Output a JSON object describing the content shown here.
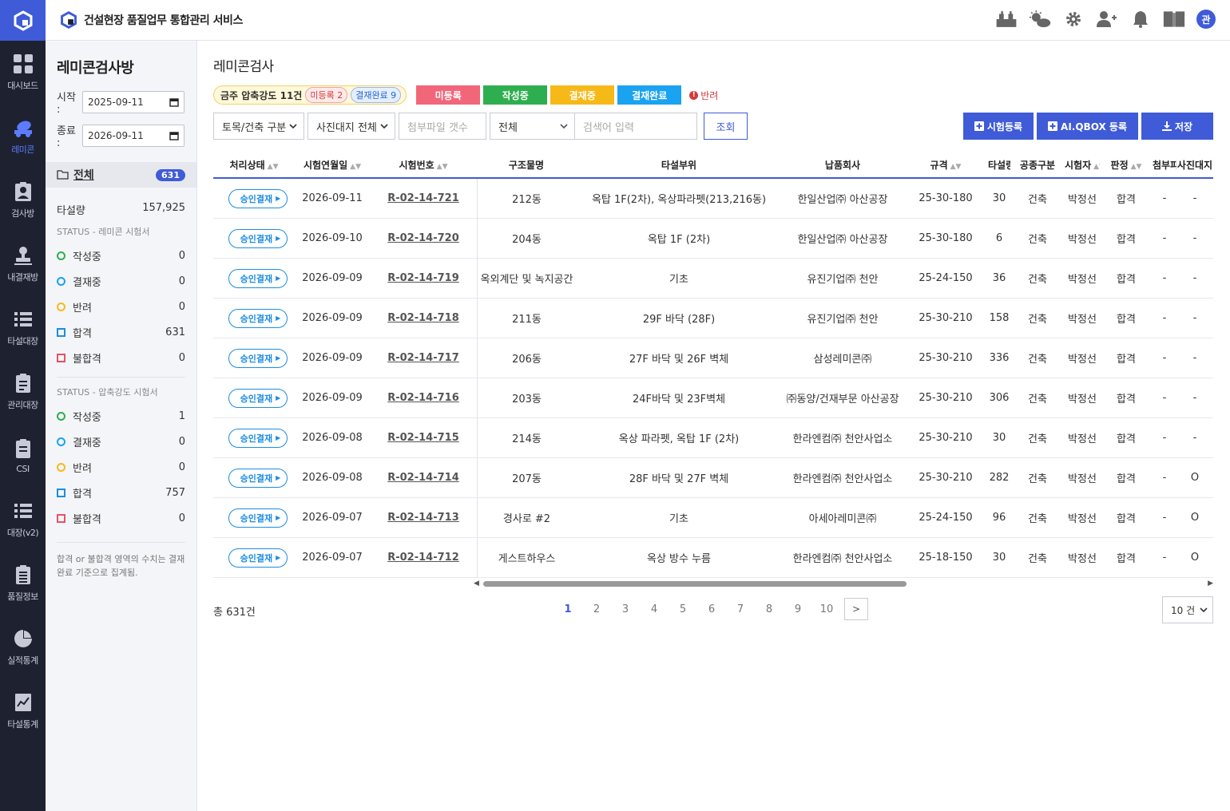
{
  "header": {
    "app_title": "건설현장 품질업무 통합관리 서비스",
    "avatar_initial": "관",
    "icons": [
      "factory-icon",
      "weather-icon",
      "settings-icon",
      "add-user-icon",
      "bell-icon",
      "book-icon"
    ]
  },
  "rail": {
    "items": [
      {
        "label": "대시보드",
        "icon": "dashboard-icon",
        "active": false
      },
      {
        "label": "레미콘",
        "icon": "mixer-truck-icon",
        "active": true
      },
      {
        "label": "검사방",
        "icon": "inspector-icon",
        "active": false
      },
      {
        "label": "내결재방",
        "icon": "stamp-icon",
        "active": false
      },
      {
        "label": "타설대장",
        "icon": "pour-ledger-icon",
        "active": false
      },
      {
        "label": "관리대장",
        "icon": "clipboard-icon",
        "active": false
      },
      {
        "label": "CSI",
        "icon": "csi-clipboard-icon",
        "active": false
      },
      {
        "label": "대장(v2)",
        "icon": "ledger-v2-icon",
        "active": false
      },
      {
        "label": "품질정보",
        "icon": "quality-list-icon",
        "active": false
      },
      {
        "label": "실적통계",
        "icon": "pie-chart-icon",
        "active": false
      },
      {
        "label": "타설통계",
        "icon": "line-chart-icon",
        "active": false
      }
    ]
  },
  "side": {
    "title": "레미콘검사방",
    "start_label": "시작 :",
    "start_value": "2025-09-11",
    "end_label": "종료 :",
    "end_value": "2026-09-11",
    "all_label": "전체",
    "all_count": "631",
    "pour_label": "타설량",
    "pour_value": "157,925",
    "status1_title": "STATUS - 레미콘 시험서",
    "status1": [
      {
        "label": "작성중",
        "value": "0"
      },
      {
        "label": "결재중",
        "value": "0"
      },
      {
        "label": "반려",
        "value": "0"
      },
      {
        "label": "합격",
        "value": "631"
      },
      {
        "label": "불합격",
        "value": "0"
      }
    ],
    "status2_title": "STATUS - 압축강도 시험서",
    "status2": [
      {
        "label": "작성중",
        "value": "1"
      },
      {
        "label": "결재중",
        "value": "0"
      },
      {
        "label": "반려",
        "value": "0"
      },
      {
        "label": "합격",
        "value": "757"
      },
      {
        "label": "불합격",
        "value": "0"
      }
    ],
    "note": "합격 or 불합격 영역의 수치는 결재완료 기준으로 집계됨."
  },
  "main": {
    "title": "레미콘검사",
    "weekly_label": "금주 압축강도 11건",
    "weekly_unregistered": "미등록 2",
    "weekly_done": "결재완료 9",
    "legend": [
      {
        "label": "미등록",
        "color": "#f2667a"
      },
      {
        "label": "작성중",
        "color": "#2fae4f"
      },
      {
        "label": "결재중",
        "color": "#f7b918"
      },
      {
        "label": "결재완료",
        "color": "#1aa3f0"
      }
    ],
    "reject_label": "반려",
    "filters": {
      "category": "토목/건축 구분",
      "photo": "사진대지 전체",
      "attach_placeholder": "첨부파일 갯수",
      "scope": "전체",
      "search_placeholder": "검색어 입력",
      "search_button": "조회"
    },
    "actions": {
      "register": "시험등록",
      "aiqbox": "AI.QBOX 등록",
      "save": "저장"
    }
  },
  "table": {
    "columns": [
      "처리상태",
      "시험연월일",
      "시험번호",
      "구조물명",
      "타설부위",
      "납품회사",
      "규격",
      "타설량",
      "공종구분",
      "시험자",
      "판정",
      "첨부파일",
      "사진대지"
    ],
    "rows": [
      {
        "status": "승인결재",
        "date": "2026-09-11",
        "no": "R-02-14-721",
        "structure": "212동",
        "part": "옥탑 1F(2차), 옥상파라펫(213,216동)",
        "company": "한일산업㈜ 아산공장",
        "spec": "25-30-180",
        "qty": "30",
        "type": "건축",
        "tester": "박정선",
        "result": "합격",
        "attach": "-",
        "photo": "-"
      },
      {
        "status": "승인결재",
        "date": "2026-09-10",
        "no": "R-02-14-720",
        "structure": "204동",
        "part": "옥탑 1F (2차)",
        "company": "한일산업㈜ 아산공장",
        "spec": "25-30-180",
        "qty": "6",
        "type": "건축",
        "tester": "박정선",
        "result": "합격",
        "attach": "-",
        "photo": "-"
      },
      {
        "status": "승인결재",
        "date": "2026-09-09",
        "no": "R-02-14-719",
        "structure": "옥외계단 및 녹지공간",
        "part": "기초",
        "company": "유진기업㈜ 천안",
        "spec": "25-24-150",
        "qty": "36",
        "type": "건축",
        "tester": "박정선",
        "result": "합격",
        "attach": "-",
        "photo": "-"
      },
      {
        "status": "승인결재",
        "date": "2026-09-09",
        "no": "R-02-14-718",
        "structure": "211동",
        "part": "29F 바닥 (28F)",
        "company": "유진기업㈜ 천안",
        "spec": "25-30-210",
        "qty": "158",
        "type": "건축",
        "tester": "박정선",
        "result": "합격",
        "attach": "-",
        "photo": "-"
      },
      {
        "status": "승인결재",
        "date": "2026-09-09",
        "no": "R-02-14-717",
        "structure": "206동",
        "part": "27F 바닥 및 26F 벽체",
        "company": "삼성레미콘㈜",
        "spec": "25-30-210",
        "qty": "336",
        "type": "건축",
        "tester": "박정선",
        "result": "합격",
        "attach": "-",
        "photo": "-"
      },
      {
        "status": "승인결재",
        "date": "2026-09-09",
        "no": "R-02-14-716",
        "structure": "203동",
        "part": "24F바닥 및 23F벽체",
        "company": "㈜동양/건재부문 아산공장",
        "spec": "25-30-210",
        "qty": "306",
        "type": "건축",
        "tester": "박정선",
        "result": "합격",
        "attach": "-",
        "photo": "-"
      },
      {
        "status": "승인결재",
        "date": "2026-09-08",
        "no": "R-02-14-715",
        "structure": "214동",
        "part": "옥상 파라펫, 옥탑 1F (2차)",
        "company": "한라엔컴㈜ 천안사업소",
        "spec": "25-30-210",
        "qty": "30",
        "type": "건축",
        "tester": "박정선",
        "result": "합격",
        "attach": "-",
        "photo": "-"
      },
      {
        "status": "승인결재",
        "date": "2026-09-08",
        "no": "R-02-14-714",
        "structure": "207동",
        "part": "28F 바닥 및 27F 벽체",
        "company": "한라엔컴㈜ 천안사업소",
        "spec": "25-30-210",
        "qty": "282",
        "type": "건축",
        "tester": "박정선",
        "result": "합격",
        "attach": "-",
        "photo": "O"
      },
      {
        "status": "승인결재",
        "date": "2026-09-07",
        "no": "R-02-14-713",
        "structure": "경사로 #2",
        "part": "기초",
        "company": "아세아레미콘㈜",
        "spec": "25-24-150",
        "qty": "96",
        "type": "건축",
        "tester": "박정선",
        "result": "합격",
        "attach": "-",
        "photo": "O"
      },
      {
        "status": "승인결재",
        "date": "2026-09-07",
        "no": "R-02-14-712",
        "structure": "게스트하우스",
        "part": "옥상 방수 누름",
        "company": "한라엔컴㈜ 천안사업소",
        "spec": "25-18-150",
        "qty": "30",
        "type": "건축",
        "tester": "박정선",
        "result": "합격",
        "attach": "-",
        "photo": "O"
      }
    ]
  },
  "footer": {
    "total": "총 631건",
    "pages": [
      "1",
      "2",
      "3",
      "4",
      "5",
      "6",
      "7",
      "8",
      "9",
      "10"
    ],
    "current_page": "1",
    "next": ">",
    "per_page": "10 건"
  }
}
